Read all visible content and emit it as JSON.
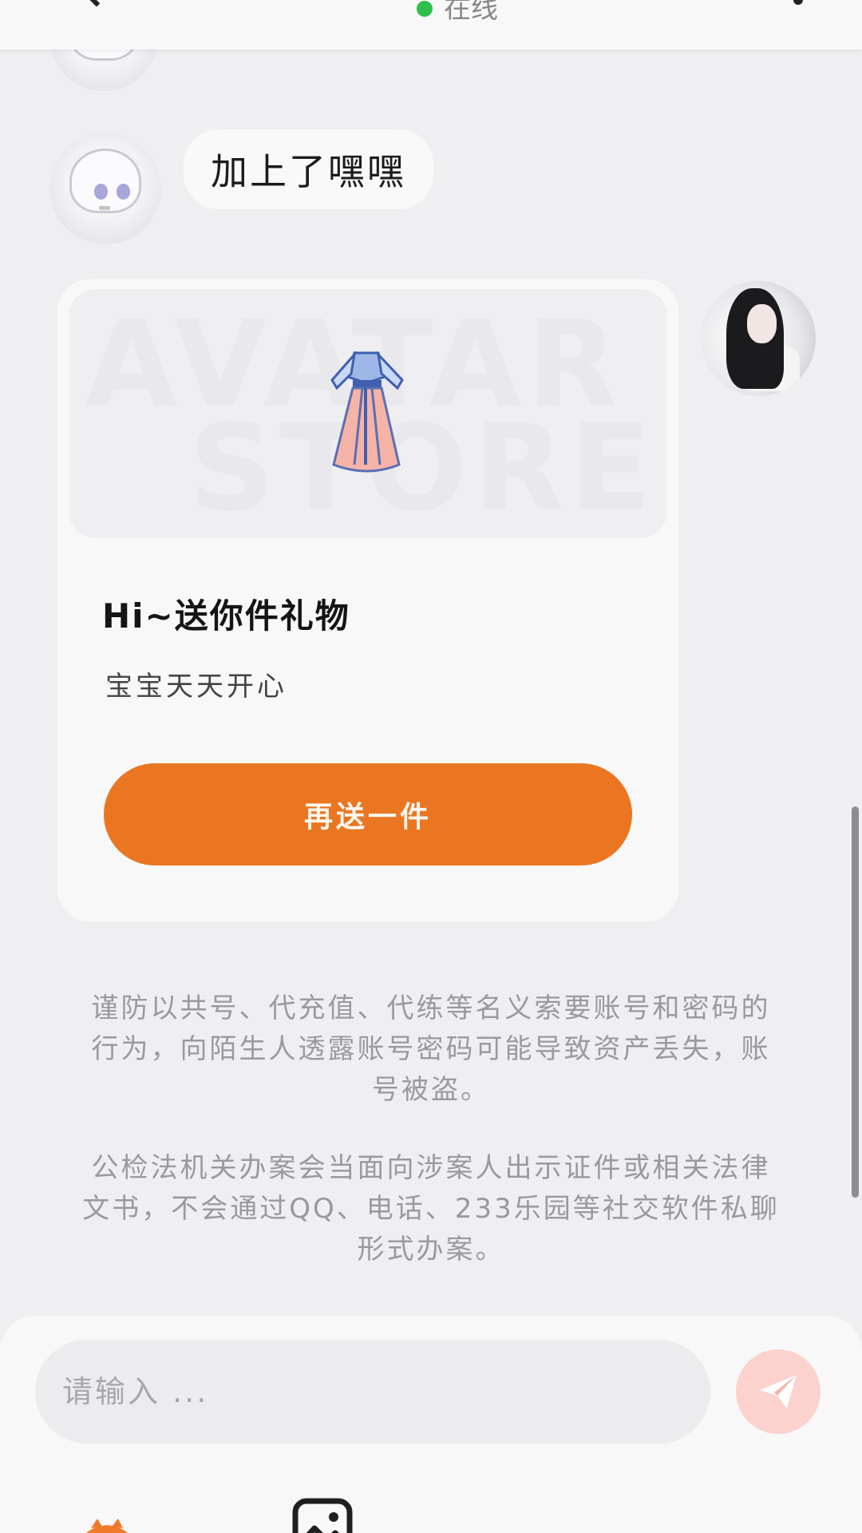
{
  "header": {
    "status_text": "在线",
    "online_color": "#2ec04b"
  },
  "messages": {
    "text_bubble": "加上了嘿嘿",
    "gift_card": {
      "banner_line1": "AVATAR",
      "banner_line2": "STORE",
      "gift_icon": "hanfu-dress-icon",
      "title": "Hi~送你件礼物",
      "subtitle": "宝宝天天开心",
      "button_label": "再送一件",
      "button_color": "#eb7622"
    }
  },
  "notice": {
    "paragraph1": "谨防以共号、代充值、代练等名义索要账号和密码的行为，向陌生人透露账号密码可能导致资产丢失，账号被盗。",
    "paragraph2": "公检法机关办案会当面向涉案人出示证件或相关法律文书，不会通过QQ、电话、233乐园等社交软件私聊形式办案。"
  },
  "composer": {
    "input_placeholder": "请输入 ...",
    "send_icon": "paper-plane-icon",
    "tools": [
      "mascot-icon",
      "image-icon"
    ]
  }
}
